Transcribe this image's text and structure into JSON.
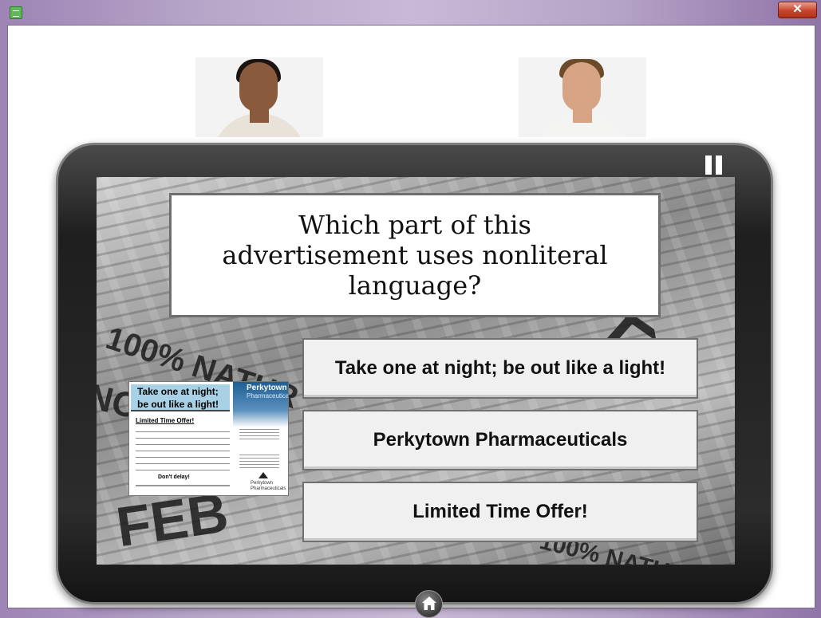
{
  "window": {
    "close_glyph": "✕",
    "app_icon": "app-icon"
  },
  "avatars": [
    {
      "name": "female-avatar"
    },
    {
      "name": "male-avatar"
    }
  ],
  "question": "Which part of this advertisement uses nonliteral language?",
  "answers": [
    "Take one at night; be out like a light!",
    "Perkytown Pharmaceuticals",
    "Limited Time Offer!"
  ],
  "ad": {
    "headline": "Take one at night; be out like a light!",
    "offer": "Limited Time Offer!",
    "cta": "Don't delay!",
    "brand_line1": "Perkytown",
    "brand_line2": "Pharmaceuticals",
    "logo_text": "Perkytown Pharmaceuticals"
  },
  "background_words": [
    "100% NATUR",
    "NO",
    "TAKE",
    "FEB",
    "100% NATU"
  ],
  "controls": {
    "pause": "pause-icon",
    "home": "home-icon"
  }
}
